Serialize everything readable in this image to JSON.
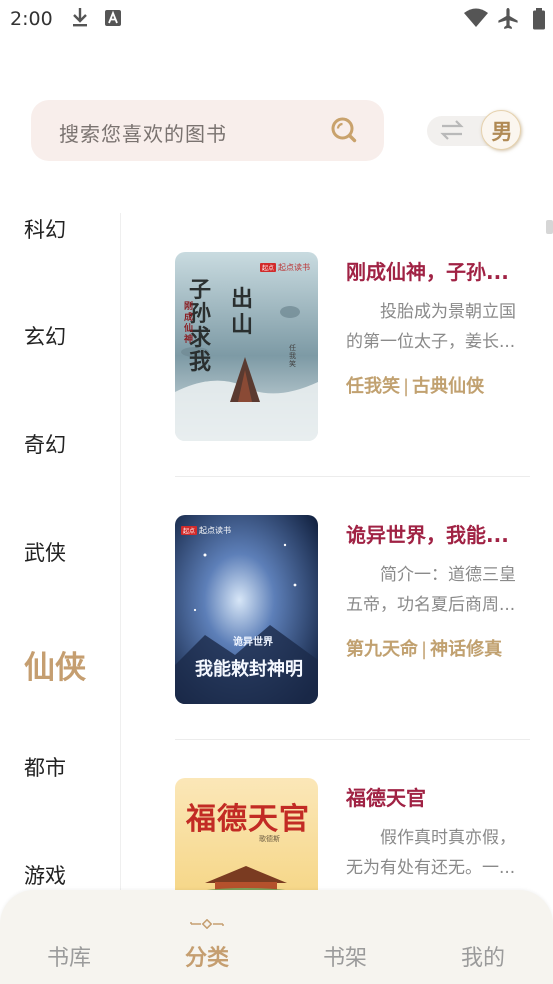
{
  "status_bar": {
    "time": "2:00",
    "icons": [
      "download-icon",
      "a-notification-icon",
      "wifi-icon",
      "airplane-icon",
      "battery-icon"
    ]
  },
  "search": {
    "placeholder": "搜索您喜欢的图书",
    "icon": "search-icon"
  },
  "gender_toggle": {
    "label": "男",
    "icon": "swap-icon"
  },
  "categories": [
    {
      "label": "科幻",
      "active": false
    },
    {
      "label": "玄幻",
      "active": false
    },
    {
      "label": "奇幻",
      "active": false
    },
    {
      "label": "武侠",
      "active": false
    },
    {
      "label": "仙侠",
      "active": true
    },
    {
      "label": "都市",
      "active": false
    },
    {
      "label": "游戏",
      "active": false
    }
  ],
  "books": [
    {
      "title": "刚成仙神，子孙...",
      "description": "投胎成为景朝立国的第一位太子，姜长...",
      "author": "任我笑",
      "genre": "古典仙侠",
      "cover": {
        "line1": "子孙求我",
        "line2": "出山",
        "side": "刚成仙神",
        "publisher": "起点读书",
        "author_mark": "任我笑"
      }
    },
    {
      "title": "诡异世界，我能...",
      "description": "简介一：道德三皇五帝，功名夏后商周...",
      "author": "第九天命",
      "genre": "神话修真",
      "cover": {
        "line1": "诡异世界",
        "line2": "我能敕封神明",
        "publisher": "起点读书"
      }
    },
    {
      "title": "福德天官",
      "description": "假作真时真亦假，无为有处有还无。一...",
      "author": "",
      "genre": "",
      "cover": {
        "line1": "福德天官",
        "author_mark": "歌德斯"
      }
    }
  ],
  "bottom_nav": [
    {
      "label": "书库",
      "active": false
    },
    {
      "label": "分类",
      "active": true
    },
    {
      "label": "书架",
      "active": false
    },
    {
      "label": "我的",
      "active": false
    }
  ],
  "colors": {
    "accent": "#c59e70",
    "title": "#a02244",
    "search_bg": "#f8eeeb",
    "nav_bg": "#f6f4ef"
  }
}
